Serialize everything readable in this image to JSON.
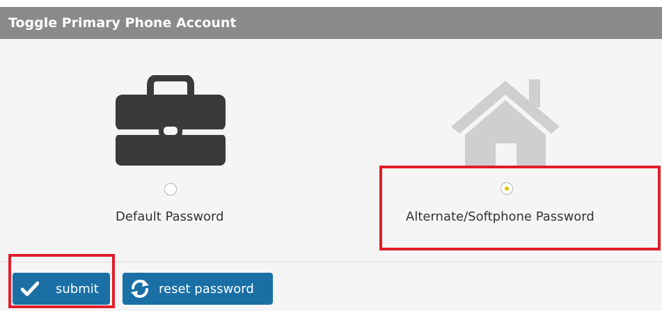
{
  "header": {
    "title": "Toggle Primary Phone Account"
  },
  "options": [
    {
      "label": "Default Password",
      "icon": "briefcase-icon",
      "selected": false
    },
    {
      "label": "Alternate/Softphone Password",
      "icon": "home-icon",
      "selected": true
    }
  ],
  "buttons": {
    "submit_label": "submit",
    "reset_label": "reset password"
  },
  "colors": {
    "header_bg": "#8a8a8a",
    "button_bg": "#1a6fa5",
    "highlight": "#e01e2a",
    "selected_dot": "#e0c000"
  }
}
